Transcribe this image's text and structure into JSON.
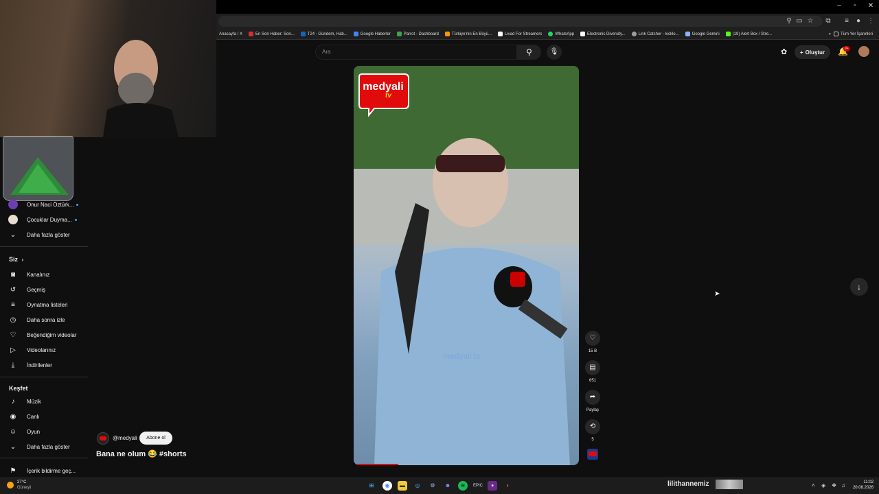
{
  "browser": {
    "bookmarks": [
      {
        "label": "Anasayfa / X",
        "color": "#000000"
      },
      {
        "label": "En Son Haber: Son...",
        "color": "#d32f2f"
      },
      {
        "label": "T24 - Gündem, Hab...",
        "color": "#1565c0"
      },
      {
        "label": "Google Haberler",
        "color": "#4285f4"
      },
      {
        "label": "Parrot - Dashboard",
        "color": "#43a047"
      },
      {
        "label": "Türkiye'nin En Büyü...",
        "color": "#ff9800"
      },
      {
        "label": "Livad For Streamers",
        "color": "#ffffff"
      },
      {
        "label": "WhatsApp",
        "color": "#25d366"
      },
      {
        "label": "Electronic Diversity...",
        "color": "#ffffff"
      },
      {
        "label": "Link Catcher - kicklo...",
        "color": "#9e9e9e"
      },
      {
        "label": "Google Gemini",
        "color": "#8ab4f8"
      },
      {
        "label": "(19) Alert Box / Stre...",
        "color": "#53fc18"
      }
    ],
    "all_bookmarks_label": "Tüm Yer İşaretleri"
  },
  "sidebar": {
    "subs_partial": "Onur Naci Öztürk...",
    "subs": [
      {
        "label": "Çocuklar Duyma..."
      }
    ],
    "more_subs": "Daha fazla göster",
    "you_heading": "Siz",
    "you_items": [
      {
        "label": "Kanalınız",
        "icon": "channel-icon"
      },
      {
        "label": "Geçmiş",
        "icon": "history-icon"
      },
      {
        "label": "Oynatma listeleri",
        "icon": "playlists-icon"
      },
      {
        "label": "Daha sonra izle",
        "icon": "watch-later-icon"
      },
      {
        "label": "Beğendiğim videolar",
        "icon": "liked-icon"
      },
      {
        "label": "Videolarınız",
        "icon": "your-videos-icon"
      },
      {
        "label": "İndirilenler",
        "icon": "downloads-icon"
      }
    ],
    "explore_heading": "Keşfet",
    "explore_items": [
      {
        "label": "Müzik",
        "icon": "music-icon"
      },
      {
        "label": "Canlı",
        "icon": "live-icon"
      },
      {
        "label": "Oyun",
        "icon": "gaming-icon"
      }
    ],
    "more_explore": "Daha fazla göster",
    "report": "İçerik bildirme geç..."
  },
  "masthead": {
    "search_placeholder": "Ara",
    "create_label": "Oluştur",
    "notif_count": "9+"
  },
  "short": {
    "logo_main": "medyali",
    "logo_sub": "tv",
    "watermark": "medyali tv",
    "channel": "@medyali",
    "subscribe": "Abone ol",
    "title": "Bana ne olum 😂 #shorts",
    "likes": "15 B",
    "comments": "651",
    "share": "Paylaş",
    "remix": "5"
  },
  "taskbar": {
    "temp": "27°C",
    "weather": "Güneşli",
    "stream_name": "lilithannemiz",
    "time": "11:02",
    "date": "20.08.2026"
  }
}
